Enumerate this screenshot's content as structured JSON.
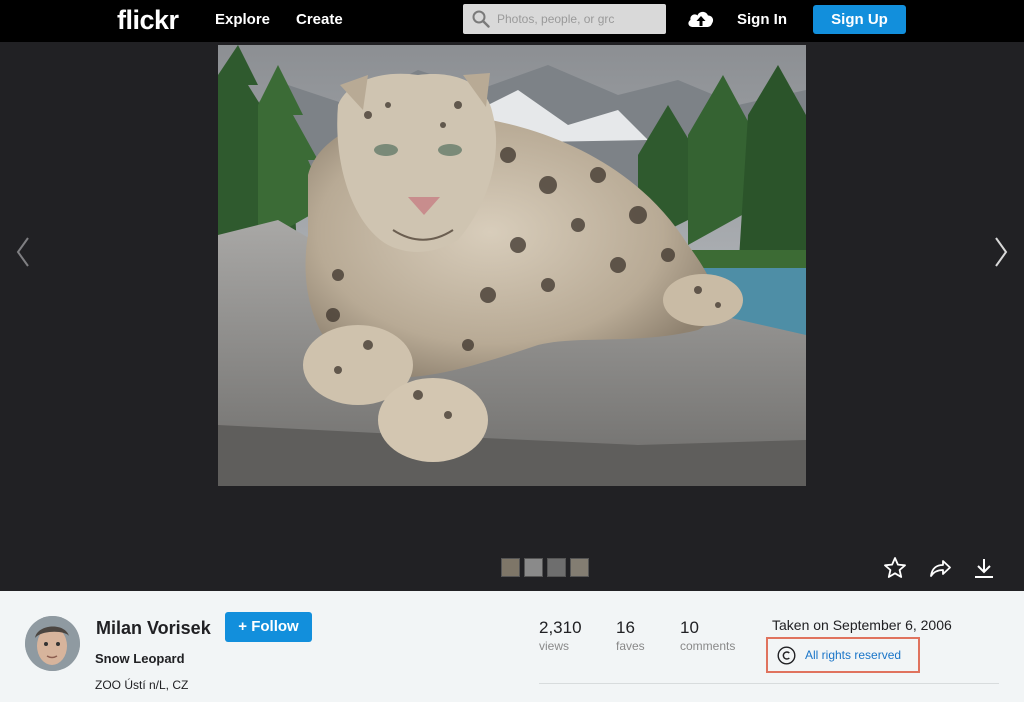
{
  "header": {
    "logo": "flickr",
    "nav": [
      "Explore",
      "Create"
    ],
    "search_placeholder": "Photos, people, or grc",
    "sign_in": "Sign In",
    "sign_up": "Sign Up"
  },
  "photo": {
    "owner": "Milan Vorisek",
    "follow_label": "+ Follow",
    "title": "Snow Leopard",
    "location": "ZOO Ústí n/L, CZ",
    "taken": "Taken on September 6, 2006",
    "license": "All rights reserved"
  },
  "stats": [
    {
      "value": "2,310",
      "label": "views"
    },
    {
      "value": "16",
      "label": "faves"
    },
    {
      "value": "10",
      "label": "comments"
    }
  ],
  "colors": {
    "brand_blue": "#128fdc",
    "highlight": "#e0735e",
    "link": "#1a75c8"
  }
}
